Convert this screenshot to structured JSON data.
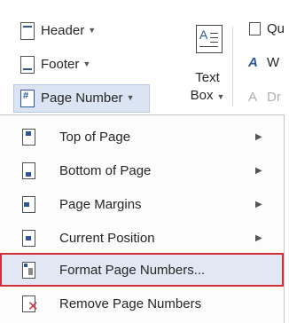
{
  "ribbon": {
    "header_label": "Header",
    "footer_label": "Footer",
    "page_number_label": "Page Number",
    "textbox_label_line1": "Text",
    "textbox_label_line2": "Box",
    "right_items": [
      "Qu",
      "W",
      "Dr"
    ]
  },
  "menu": {
    "items": [
      {
        "label": "Top of Page",
        "has_submenu": true
      },
      {
        "label": "Bottom of Page",
        "has_submenu": true
      },
      {
        "label": "Page Margins",
        "has_submenu": true
      },
      {
        "label": "Current Position",
        "has_submenu": true
      },
      {
        "label": "Format Page Numbers...",
        "has_submenu": false,
        "highlighted": true
      },
      {
        "label": "Remove Page Numbers",
        "has_submenu": false
      }
    ]
  },
  "colors": {
    "accent": "#2b579a",
    "highlight_border": "#d0313b",
    "highlight_fill": "#e1e8f3",
    "active_button": "#dbe4f2"
  },
  "icons": {
    "header": "header-doc-icon",
    "footer": "footer-doc-icon",
    "page_number": "page-number-icon",
    "text_box": "text-box-icon",
    "remove": "remove-page-numbers-icon"
  }
}
